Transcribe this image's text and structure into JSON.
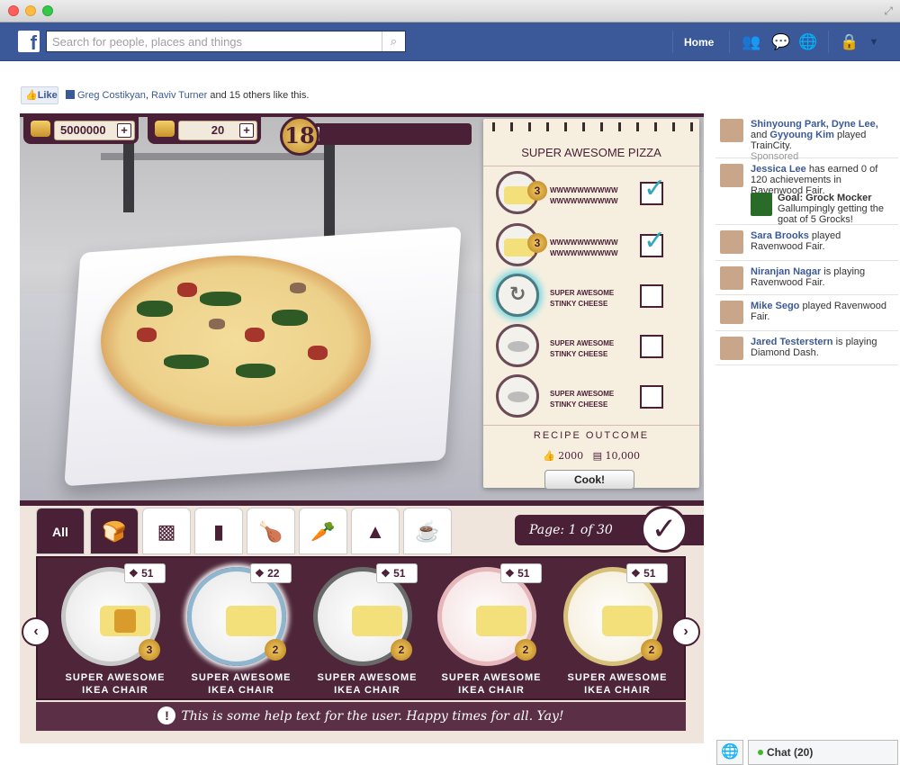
{
  "search": {
    "placeholder": "Search for people, places and things"
  },
  "nav": {
    "home": "Home"
  },
  "like": {
    "button": "Like",
    "friend1": "Greg Costikyan",
    "sep": ", ",
    "friend2": "Raviv Turner",
    "rest": " and 15 others like this."
  },
  "hud": {
    "coins": "5000000",
    "dough": "20",
    "level": "18",
    "xp_fraction": 0.02
  },
  "recipe": {
    "title": "SUPER AWESOME PIZZA",
    "ingredients": [
      {
        "line1": "WWWWWWWWWW",
        "line2": "WWWWWWWWWW",
        "badge": "3",
        "checked": true
      },
      {
        "line1": "WWWWWWWWWW",
        "line2": "WWWWWWWWWW",
        "badge": "3",
        "checked": true
      },
      {
        "line1": "SUPER AWESOME",
        "line2": "STINKY CHEESE",
        "checked": false
      },
      {
        "line1": "SUPER AWESOME",
        "line2": "STINKY CHEESE",
        "checked": false
      },
      {
        "line1": "SUPER AWESOME",
        "line2": "STINKY CHEESE",
        "checked": false
      }
    ],
    "outcome_label": "RECIPE OUTCOME",
    "outcome_likes": "2000",
    "outcome_coins": "10,000",
    "cook_label": "Cook!"
  },
  "tabs": {
    "all": "All"
  },
  "page": {
    "label": "Page:",
    "value": "1 of 30"
  },
  "items": [
    {
      "count": "51",
      "badge": "3",
      "name1": "SUPER AWESOME",
      "name2": "IKEA CHAIR"
    },
    {
      "count": "22",
      "badge": "2",
      "name1": "SUPER AWESOME",
      "name2": "IKEA CHAIR"
    },
    {
      "count": "51",
      "badge": "2",
      "name1": "SUPER AWESOME",
      "name2": "IKEA CHAIR"
    },
    {
      "count": "51",
      "badge": "2",
      "name1": "SUPER AWESOME",
      "name2": "IKEA CHAIR"
    },
    {
      "count": "51",
      "badge": "2",
      "name1": "SUPER AWESOME",
      "name2": "IKEA CHAIR"
    }
  ],
  "help": {
    "text": "This is some help text for the user. Happy times for all. Yay!"
  },
  "ticker": [
    {
      "bold": "Shinyoung Park, Dyne Lee,",
      "rest": " and ",
      "bold2": "Gyyoung Kim",
      "rest2": " played TrainCity.",
      "sub": "Sponsored"
    },
    {
      "bold": "Jessica Lee",
      "rest": " has earned 0 of 120 achievements in Ravenwood Fair.",
      "goal_title": "Goal: Grock Mocker",
      "goal_text": "Gallumpingly getting the goat of 5 Grocks!"
    },
    {
      "bold": "Sara Brooks",
      "rest": " played Ravenwood Fair."
    },
    {
      "bold": "Niranjan Nagar",
      "rest": " is playing Ravenwood Fair."
    },
    {
      "bold": "Mike Sego",
      "rest": " played Ravenwood Fair."
    },
    {
      "bold": "Jared Testerstern",
      "rest": " is playing Diamond Dash."
    }
  ],
  "chat": {
    "label": "Chat (20)"
  }
}
